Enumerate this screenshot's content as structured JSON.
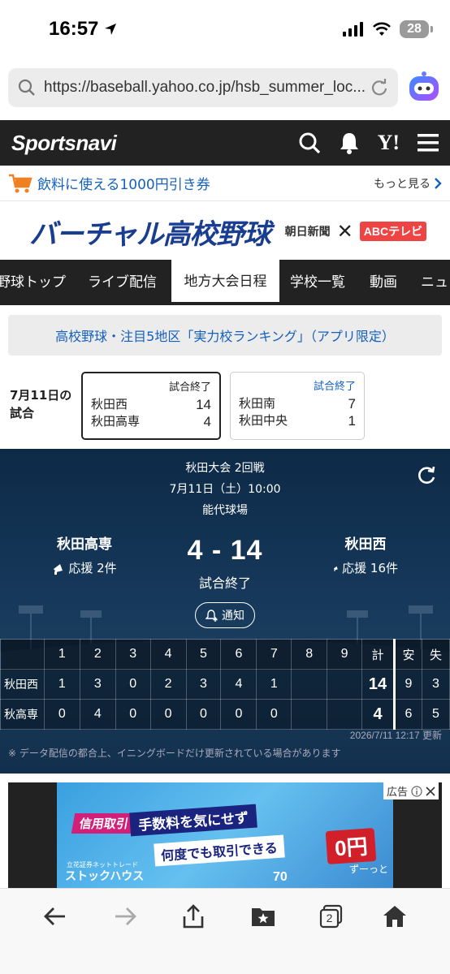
{
  "status_bar": {
    "time": "16:57",
    "battery": "28"
  },
  "browser": {
    "url": "https://baseball.yahoo.co.jp/hsb_summer_loc..."
  },
  "header": {
    "logo": "Sportsnavi"
  },
  "promo": {
    "text": "飲料に使える1000円引き券",
    "more": "もっと見る"
  },
  "banner": {
    "title": "バーチャル高校野球",
    "partner1": "朝日新聞",
    "separator": "✕",
    "partner2": "ABCテレビ"
  },
  "nav": {
    "tabs": [
      "野球トップ",
      "ライブ配信",
      "地方大会日程",
      "学校一覧",
      "動画",
      "ニュ"
    ],
    "active": "地方大会日程"
  },
  "notice": {
    "text": "高校野球・注目5地区「実力校ランキング」（アプリ限定）"
  },
  "games": {
    "label_line1": "7月11日の",
    "label_line2": "試合",
    "cards": [
      {
        "status": "試合終了",
        "team1": "秋田西",
        "score1": "14",
        "team2": "秋田高専",
        "score2": "4"
      },
      {
        "status": "試合終了",
        "team1": "秋田南",
        "score1": "7",
        "team2": "秋田中央",
        "score2": "1"
      }
    ]
  },
  "match": {
    "round": "秋田大会 2回戦",
    "date": "7月11日（土）10:00",
    "venue": "能代球場",
    "home": {
      "name": "秋田高専",
      "cheer": "応援 2件"
    },
    "away": {
      "name": "秋田西",
      "cheer": "応援 16件"
    },
    "score": "4 - 14",
    "status": "試合終了",
    "notify_label": "通知"
  },
  "scoreboard": {
    "headers": [
      "",
      "1",
      "2",
      "3",
      "4",
      "5",
      "6",
      "7",
      "8",
      "9",
      "計",
      "安",
      "失"
    ],
    "rows": [
      {
        "team": "秋田西",
        "innings": [
          "1",
          "3",
          "0",
          "2",
          "3",
          "4",
          "1",
          "",
          ""
        ],
        "total": "14",
        "hits": "9",
        "errors": "3"
      },
      {
        "team": "秋高専",
        "innings": [
          "0",
          "4",
          "0",
          "0",
          "0",
          "0",
          "0",
          "",
          ""
        ],
        "total": "4",
        "hits": "6",
        "errors": "5"
      }
    ],
    "updated": "2026/7/11 12:17 更新",
    "disclaimer": "※ データ配信の都合上、イニングボードだけ更新されている場合があります"
  },
  "ad": {
    "badge": "広告",
    "line1": "信用取引",
    "line2": "手数料を気にせず",
    "line3": "何度でも取引できる",
    "price": "0円",
    "price_sub": "ずーっと",
    "brand_small": "立花証券ネットトレード",
    "brand": "ストックハウス",
    "num": "70"
  },
  "bottom_bar": {
    "tab_count": "2"
  },
  "colors": {
    "link": "#1560bd",
    "header_bg": "#222222",
    "hero_bg": "#16385a",
    "promo_cart": "#f08020"
  }
}
